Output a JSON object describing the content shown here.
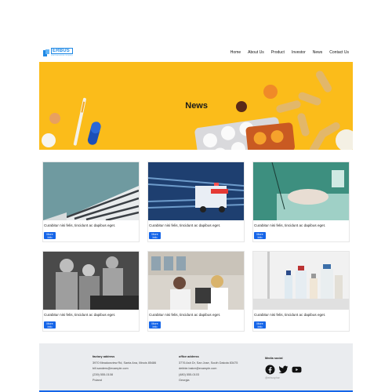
{
  "brand": {
    "name": "ERBUS",
    "tagline": "pharmaceutical company"
  },
  "nav": {
    "items": [
      "Home",
      "About Us",
      "Product",
      "Investor",
      "News",
      "Contact Us"
    ]
  },
  "hero": {
    "title": "News"
  },
  "cards": [
    {
      "text": "Curabitur nisi felis, tincidunt ac dapibus eget.",
      "button": "More Info",
      "image": "modern-building"
    },
    {
      "text": "Curabitur nisi felis, tincidunt ac dapibus eget.",
      "button": "More Info",
      "image": "ambulance"
    },
    {
      "text": "Curabitur nisi felis, tincidunt ac dapibus eget.",
      "button": "More Info",
      "image": "hospital-bed"
    },
    {
      "text": "Curabitur nisi felis, tincidunt ac dapibus eget.",
      "button": "More Info",
      "image": "surgery-team"
    },
    {
      "text": "Curabitur nisi felis, tincidunt ac dapibus eget.",
      "button": "More Info",
      "image": "pharmacy"
    },
    {
      "text": "Curabitur nisi felis, tincidunt ac dapibus eget.",
      "button": "More Info",
      "image": "medicine-bottles"
    }
  ],
  "footer": {
    "factory": {
      "heading": "factory address",
      "lines": [
        "3970 Meadowview Rd, Santa Ana, Illinois 85486",
        "bill.sanders@example.com",
        "(239) 555-0108",
        "Poland"
      ]
    },
    "office": {
      "heading": "office address",
      "lines": [
        "3776 Ash Dr, San Jose, South Dakota 83475",
        "debbie.baker@example.com",
        "(480) 555-0103",
        "Georgia"
      ]
    },
    "social": {
      "heading": "Media social",
      "handle": "@erbusphar",
      "icons": [
        "facebook-icon",
        "twitter-icon",
        "youtube-icon"
      ]
    }
  },
  "colors": {
    "accent": "#1565e8",
    "hero_bg": "#fbbc1a",
    "footer_bg": "#eaecef",
    "brand": "#1e88e5"
  }
}
